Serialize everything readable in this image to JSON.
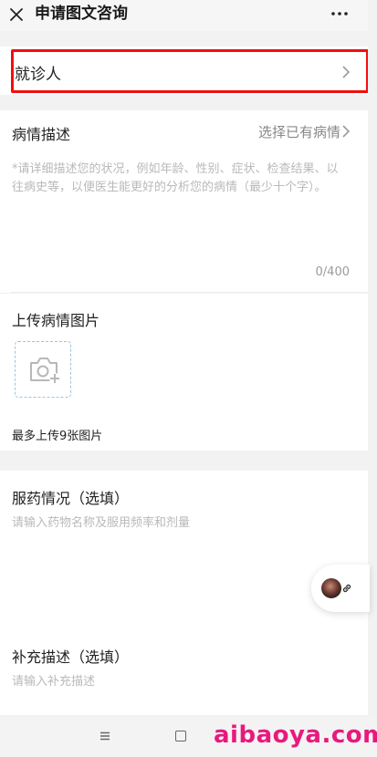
{
  "header": {
    "title": "申请图文咨询"
  },
  "patient": {
    "label": "就诊人"
  },
  "description": {
    "title": "病情描述",
    "select_link": "选择已有病情",
    "placeholder": "*请详细描述您的状况，例如年龄、性别、症状、检查结果、以往病史等，以便医生能更好的分析您的病情（最少十个字）。",
    "counter": "0/400"
  },
  "photos": {
    "title": "上传病情图片",
    "hint": "最多上传9张图片"
  },
  "medication": {
    "title": "服药情况（选填）",
    "placeholder": "请输入药物名称及服用频率和剂量"
  },
  "supplement": {
    "title": "补充描述（选填）",
    "placeholder": "请输入补充描述"
  },
  "watermark": "aibaoya.com",
  "colors": {
    "highlight": "#f20d0d",
    "watermark": "#e8197d",
    "upload_border": "#9fc3dc"
  },
  "icons": [
    "close-icon",
    "more-icon",
    "chevron-right-icon",
    "camera-add-icon",
    "link-icon",
    "menu-icon",
    "home-icon"
  ]
}
